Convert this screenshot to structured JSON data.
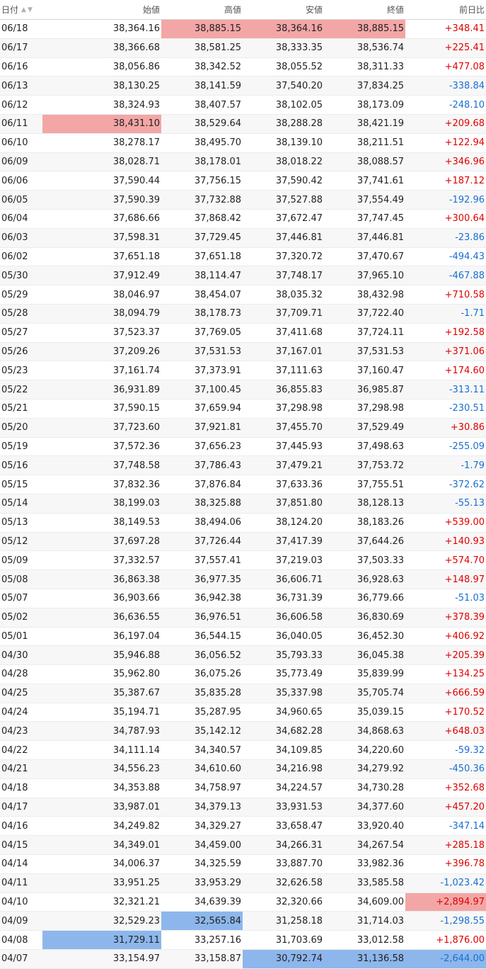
{
  "headers": {
    "date": "日付",
    "open": "始値",
    "high": "高値",
    "low": "安値",
    "close": "終値",
    "change": "前日比",
    "sort_up": "▲",
    "sort_down": "▼"
  },
  "colors": {
    "positive": "#e00000",
    "negative": "#1a6fd1",
    "highlight_max": "#f3a6a6",
    "highlight_min": "#8db7ec"
  },
  "rows": [
    {
      "date": "06/18",
      "open": "38,364.16",
      "high": "38,885.15",
      "low": "38,364.16",
      "close": "38,885.15",
      "change": "+348.41",
      "hl": [
        "high",
        "low",
        "close"
      ]
    },
    {
      "date": "06/17",
      "open": "38,366.68",
      "high": "38,581.25",
      "low": "38,333.35",
      "close": "38,536.74",
      "change": "+225.41"
    },
    {
      "date": "06/16",
      "open": "38,056.86",
      "high": "38,342.52",
      "low": "38,055.52",
      "close": "38,311.33",
      "change": "+477.08"
    },
    {
      "date": "06/13",
      "open": "38,130.25",
      "high": "38,141.59",
      "low": "37,540.20",
      "close": "37,834.25",
      "change": "-338.84"
    },
    {
      "date": "06/12",
      "open": "38,324.93",
      "high": "38,407.57",
      "low": "38,102.05",
      "close": "38,173.09",
      "change": "-248.10"
    },
    {
      "date": "06/11",
      "open": "38,431.10",
      "high": "38,529.64",
      "low": "38,288.28",
      "close": "38,421.19",
      "change": "+209.68",
      "hl": [
        "open"
      ]
    },
    {
      "date": "06/10",
      "open": "38,278.17",
      "high": "38,495.70",
      "low": "38,139.10",
      "close": "38,211.51",
      "change": "+122.94"
    },
    {
      "date": "06/09",
      "open": "38,028.71",
      "high": "38,178.01",
      "low": "38,018.22",
      "close": "38,088.57",
      "change": "+346.96"
    },
    {
      "date": "06/06",
      "open": "37,590.44",
      "high": "37,756.15",
      "low": "37,590.42",
      "close": "37,741.61",
      "change": "+187.12"
    },
    {
      "date": "06/05",
      "open": "37,590.39",
      "high": "37,732.88",
      "low": "37,527.88",
      "close": "37,554.49",
      "change": "-192.96"
    },
    {
      "date": "06/04",
      "open": "37,686.66",
      "high": "37,868.42",
      "low": "37,672.47",
      "close": "37,747.45",
      "change": "+300.64"
    },
    {
      "date": "06/03",
      "open": "37,598.31",
      "high": "37,729.45",
      "low": "37,446.81",
      "close": "37,446.81",
      "change": "-23.86"
    },
    {
      "date": "06/02",
      "open": "37,651.18",
      "high": "37,651.18",
      "low": "37,320.72",
      "close": "37,470.67",
      "change": "-494.43"
    },
    {
      "date": "05/30",
      "open": "37,912.49",
      "high": "38,114.47",
      "low": "37,748.17",
      "close": "37,965.10",
      "change": "-467.88"
    },
    {
      "date": "05/29",
      "open": "38,046.97",
      "high": "38,454.07",
      "low": "38,035.32",
      "close": "38,432.98",
      "change": "+710.58"
    },
    {
      "date": "05/28",
      "open": "38,094.79",
      "high": "38,178.73",
      "low": "37,709.71",
      "close": "37,722.40",
      "change": "-1.71"
    },
    {
      "date": "05/27",
      "open": "37,523.37",
      "high": "37,769.05",
      "low": "37,411.68",
      "close": "37,724.11",
      "change": "+192.58"
    },
    {
      "date": "05/26",
      "open": "37,209.26",
      "high": "37,531.53",
      "low": "37,167.01",
      "close": "37,531.53",
      "change": "+371.06"
    },
    {
      "date": "05/23",
      "open": "37,161.74",
      "high": "37,373.91",
      "low": "37,111.63",
      "close": "37,160.47",
      "change": "+174.60"
    },
    {
      "date": "05/22",
      "open": "36,931.89",
      "high": "37,100.45",
      "low": "36,855.83",
      "close": "36,985.87",
      "change": "-313.11"
    },
    {
      "date": "05/21",
      "open": "37,590.15",
      "high": "37,659.94",
      "low": "37,298.98",
      "close": "37,298.98",
      "change": "-230.51"
    },
    {
      "date": "05/20",
      "open": "37,723.60",
      "high": "37,921.81",
      "low": "37,455.70",
      "close": "37,529.49",
      "change": "+30.86"
    },
    {
      "date": "05/19",
      "open": "37,572.36",
      "high": "37,656.23",
      "low": "37,445.93",
      "close": "37,498.63",
      "change": "-255.09"
    },
    {
      "date": "05/16",
      "open": "37,748.58",
      "high": "37,786.43",
      "low": "37,479.21",
      "close": "37,753.72",
      "change": "-1.79"
    },
    {
      "date": "05/15",
      "open": "37,832.36",
      "high": "37,876.84",
      "low": "37,633.36",
      "close": "37,755.51",
      "change": "-372.62"
    },
    {
      "date": "05/14",
      "open": "38,199.03",
      "high": "38,325.88",
      "low": "37,851.80",
      "close": "38,128.13",
      "change": "-55.13"
    },
    {
      "date": "05/13",
      "open": "38,149.53",
      "high": "38,494.06",
      "low": "38,124.20",
      "close": "38,183.26",
      "change": "+539.00"
    },
    {
      "date": "05/12",
      "open": "37,697.28",
      "high": "37,726.44",
      "low": "37,417.39",
      "close": "37,644.26",
      "change": "+140.93"
    },
    {
      "date": "05/09",
      "open": "37,332.57",
      "high": "37,557.41",
      "low": "37,219.03",
      "close": "37,503.33",
      "change": "+574.70"
    },
    {
      "date": "05/08",
      "open": "36,863.38",
      "high": "36,977.35",
      "low": "36,606.71",
      "close": "36,928.63",
      "change": "+148.97"
    },
    {
      "date": "05/07",
      "open": "36,903.66",
      "high": "36,942.38",
      "low": "36,731.39",
      "close": "36,779.66",
      "change": "-51.03"
    },
    {
      "date": "05/02",
      "open": "36,636.55",
      "high": "36,976.51",
      "low": "36,606.58",
      "close": "36,830.69",
      "change": "+378.39"
    },
    {
      "date": "05/01",
      "open": "36,197.04",
      "high": "36,544.15",
      "low": "36,040.05",
      "close": "36,452.30",
      "change": "+406.92"
    },
    {
      "date": "04/30",
      "open": "35,946.88",
      "high": "36,056.52",
      "low": "35,793.33",
      "close": "36,045.38",
      "change": "+205.39"
    },
    {
      "date": "04/28",
      "open": "35,962.80",
      "high": "36,075.26",
      "low": "35,773.49",
      "close": "35,839.99",
      "change": "+134.25"
    },
    {
      "date": "04/25",
      "open": "35,387.67",
      "high": "35,835.28",
      "low": "35,337.98",
      "close": "35,705.74",
      "change": "+666.59"
    },
    {
      "date": "04/24",
      "open": "35,194.71",
      "high": "35,287.95",
      "low": "34,960.65",
      "close": "35,039.15",
      "change": "+170.52"
    },
    {
      "date": "04/23",
      "open": "34,787.93",
      "high": "35,142.12",
      "low": "34,682.28",
      "close": "34,868.63",
      "change": "+648.03"
    },
    {
      "date": "04/22",
      "open": "34,111.14",
      "high": "34,340.57",
      "low": "34,109.85",
      "close": "34,220.60",
      "change": "-59.32"
    },
    {
      "date": "04/21",
      "open": "34,556.23",
      "high": "34,610.60",
      "low": "34,216.98",
      "close": "34,279.92",
      "change": "-450.36"
    },
    {
      "date": "04/18",
      "open": "34,353.88",
      "high": "34,758.97",
      "low": "34,224.57",
      "close": "34,730.28",
      "change": "+352.68"
    },
    {
      "date": "04/17",
      "open": "33,987.01",
      "high": "34,379.13",
      "low": "33,931.53",
      "close": "34,377.60",
      "change": "+457.20"
    },
    {
      "date": "04/16",
      "open": "34,249.82",
      "high": "34,329.27",
      "low": "33,658.47",
      "close": "33,920.40",
      "change": "-347.14"
    },
    {
      "date": "04/15",
      "open": "34,349.01",
      "high": "34,459.00",
      "low": "34,266.31",
      "close": "34,267.54",
      "change": "+285.18"
    },
    {
      "date": "04/14",
      "open": "34,006.37",
      "high": "34,325.59",
      "low": "33,887.70",
      "close": "33,982.36",
      "change": "+396.78"
    },
    {
      "date": "04/11",
      "open": "33,951.25",
      "high": "33,953.29",
      "low": "32,626.58",
      "close": "33,585.58",
      "change": "-1,023.42"
    },
    {
      "date": "04/10",
      "open": "32,321.21",
      "high": "34,639.39",
      "low": "32,320.66",
      "close": "34,609.00",
      "change": "+2,894.97",
      "hl": [
        "change"
      ]
    },
    {
      "date": "04/09",
      "open": "32,529.23",
      "high": "32,565.84",
      "low": "31,258.18",
      "close": "31,714.03",
      "change": "-1,298.55",
      "hlb": [
        "high"
      ]
    },
    {
      "date": "04/08",
      "open": "31,729.11",
      "high": "33,257.16",
      "low": "31,703.69",
      "close": "33,012.58",
      "change": "+1,876.00",
      "hlb": [
        "open"
      ]
    },
    {
      "date": "04/07",
      "open": "33,154.97",
      "high": "33,158.87",
      "low": "30,792.74",
      "close": "31,136.58",
      "change": "-2,644.00",
      "hlb": [
        "low",
        "close",
        "change"
      ]
    }
  ]
}
